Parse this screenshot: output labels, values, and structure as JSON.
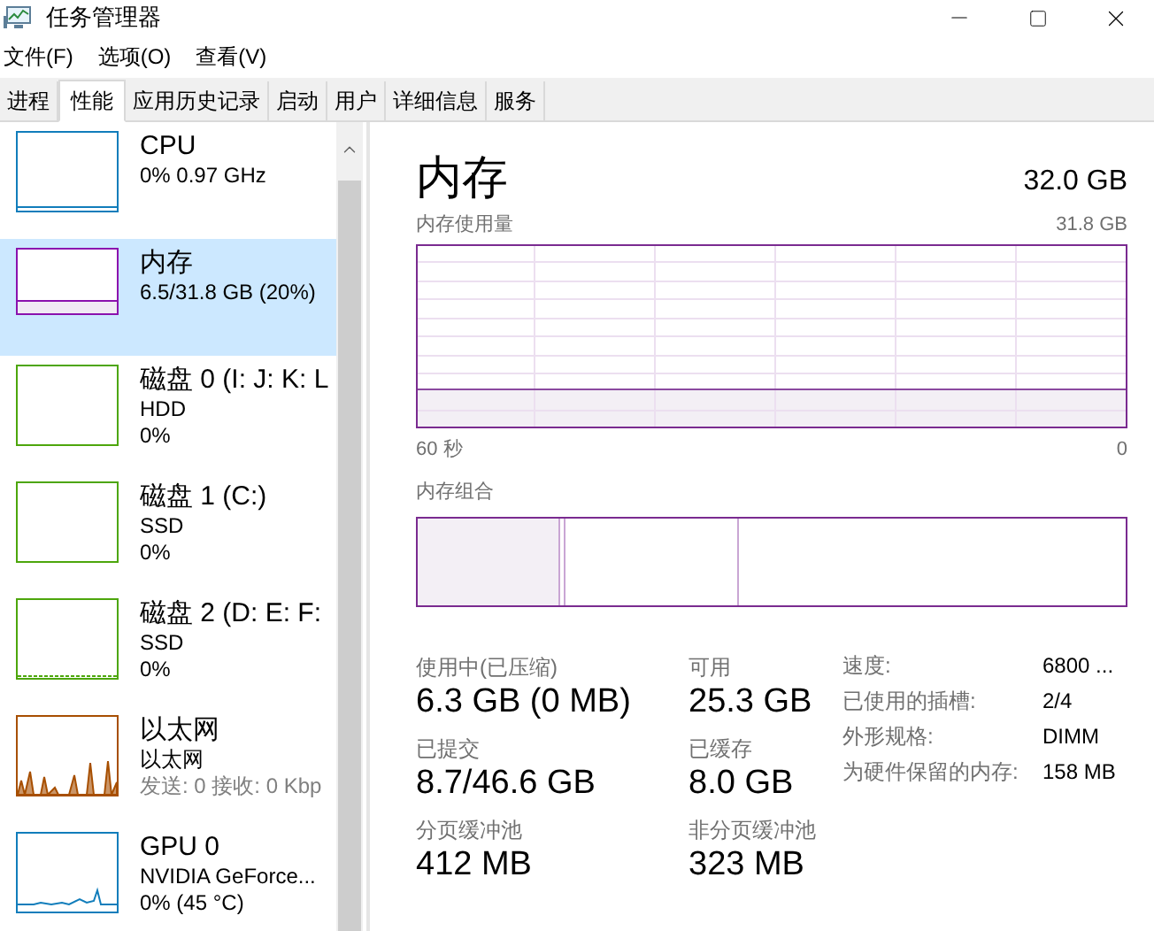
{
  "window": {
    "title": "任务管理器"
  },
  "menu": [
    "文件(F)",
    "选项(O)",
    "查看(V)"
  ],
  "tabs": [
    {
      "label": "进程",
      "selected": false
    },
    {
      "label": "性能",
      "selected": true
    },
    {
      "label": "应用历史记录",
      "selected": false
    },
    {
      "label": "启动",
      "selected": false
    },
    {
      "label": "用户",
      "selected": false
    },
    {
      "label": "详细信息",
      "selected": false
    },
    {
      "label": "服务",
      "selected": false
    }
  ],
  "sidebar": {
    "items": [
      {
        "title": "CPU",
        "lines": [
          {
            "text": "0% 0.97 GHz",
            "muted": false
          }
        ],
        "selected": false,
        "color": "#117dbb"
      },
      {
        "title": "内存",
        "lines": [
          {
            "text": "6.5/31.8 GB (20%)",
            "muted": false
          }
        ],
        "selected": true,
        "color": "#8b12ae"
      },
      {
        "title": "磁盘 0 (I: J: K: L",
        "lines": [
          {
            "text": "HDD",
            "muted": false
          },
          {
            "text": "0%",
            "muted": false
          }
        ],
        "selected": false,
        "color": "#4da60c"
      },
      {
        "title": "磁盘 1 (C:)",
        "lines": [
          {
            "text": "SSD",
            "muted": false
          },
          {
            "text": "0%",
            "muted": false
          }
        ],
        "selected": false,
        "color": "#4da60c"
      },
      {
        "title": "磁盘 2 (D: E: F:",
        "lines": [
          {
            "text": "SSD",
            "muted": false
          },
          {
            "text": "0%",
            "muted": false
          }
        ],
        "selected": false,
        "color": "#4da60c"
      },
      {
        "title": "以太网",
        "lines": [
          {
            "text": "以太网",
            "muted": false
          },
          {
            "text": "发送: 0 接收: 0 Kbp",
            "muted": true
          }
        ],
        "selected": false,
        "color": "#a74f01"
      },
      {
        "title": "GPU 0",
        "lines": [
          {
            "text": "NVIDIA GeForce...",
            "muted": false
          },
          {
            "text": "0% (45 °C)",
            "muted": false
          }
        ],
        "selected": false,
        "color": "#117dbb"
      }
    ]
  },
  "detail": {
    "title": "内存",
    "total": "32.0 GB",
    "usage_chart": {
      "label": "内存使用量",
      "max": "31.8 GB",
      "x_start": "60 秒",
      "x_end": "0"
    },
    "composition_label": "内存组合",
    "stats": [
      {
        "label": "使用中(已压缩)",
        "value": "6.3 GB (0 MB)"
      },
      {
        "label": "可用",
        "value": "25.3 GB"
      },
      {
        "label": "已提交",
        "value": "8.7/46.6 GB"
      },
      {
        "label": "已缓存",
        "value": "8.0 GB"
      },
      {
        "label": "分页缓冲池",
        "value": "412 MB"
      },
      {
        "label": "非分页缓冲池",
        "value": "323 MB"
      }
    ],
    "properties": [
      {
        "key": "速度:",
        "value": "6800 ..."
      },
      {
        "key": "已使用的插槽:",
        "value": "2/4"
      },
      {
        "key": "外形规格:",
        "value": "DIMM"
      },
      {
        "key": "为硬件保留的内存:",
        "value": "158 MB"
      }
    ]
  }
}
